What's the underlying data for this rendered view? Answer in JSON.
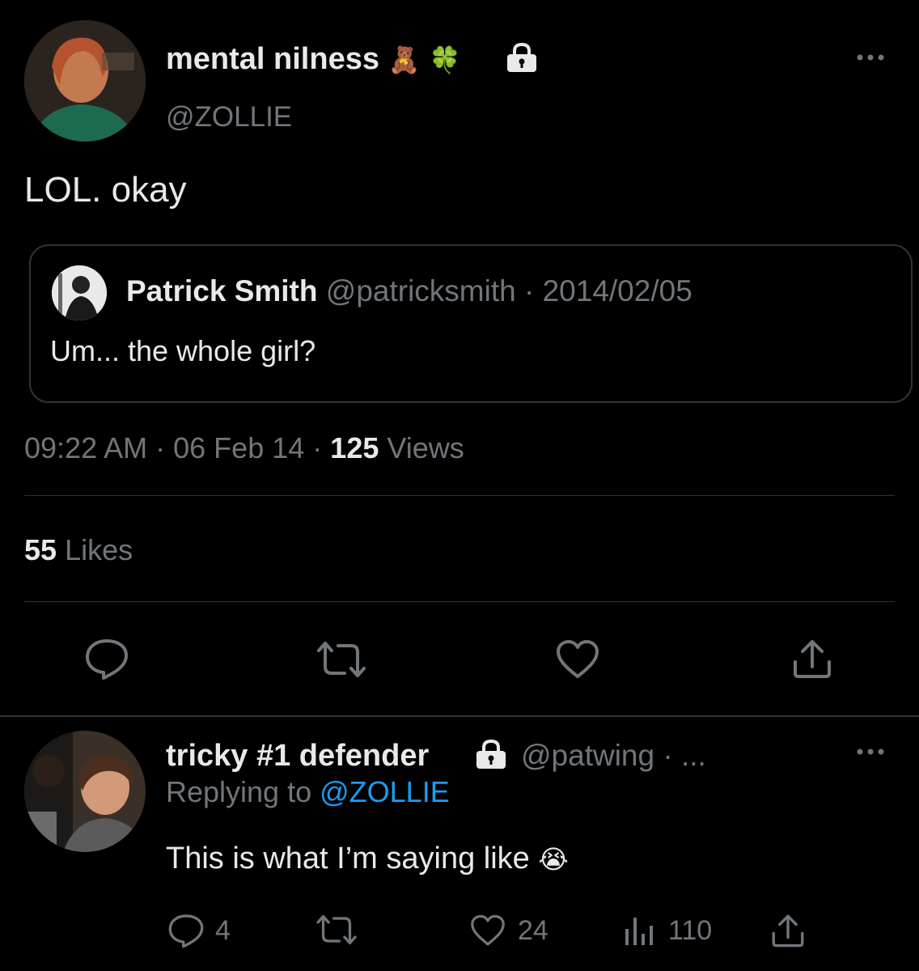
{
  "tweet": {
    "author": {
      "display_name": "mental nilness",
      "emoji1": "🧸",
      "emoji2": "🍀",
      "handle": "@ZOLLIE",
      "avatar_icon": "profile-photo"
    },
    "text": "LOL. okay",
    "quote": {
      "display_name": "Patrick Smith",
      "handle": "@patricksmith",
      "separator": "·",
      "date": "2014/02/05",
      "text": "Um... the whole girl?"
    },
    "meta": {
      "time": "09:22 AM",
      "separator1": "·",
      "date": "06 Feb 14",
      "separator2": "·",
      "views_count": "125",
      "views_label": "Views"
    },
    "likes": {
      "count": "55",
      "label": "Likes"
    }
  },
  "reply": {
    "author": {
      "display_name": "tricky #1 defender",
      "handle": "@patwing",
      "separator": "·",
      "ellipsis": "..."
    },
    "replying_label": "Replying to",
    "replying_handle": "@ZOLLIE",
    "text": "This is what I’m saying like",
    "emoji": "😭",
    "stats": {
      "replies": "4",
      "likes": "24",
      "views": "110"
    }
  },
  "colors": {
    "background": "#000000",
    "text": "#e7e9ea",
    "muted": "#71767b",
    "link": "#1d9bf0",
    "divider": "#2f3336"
  }
}
